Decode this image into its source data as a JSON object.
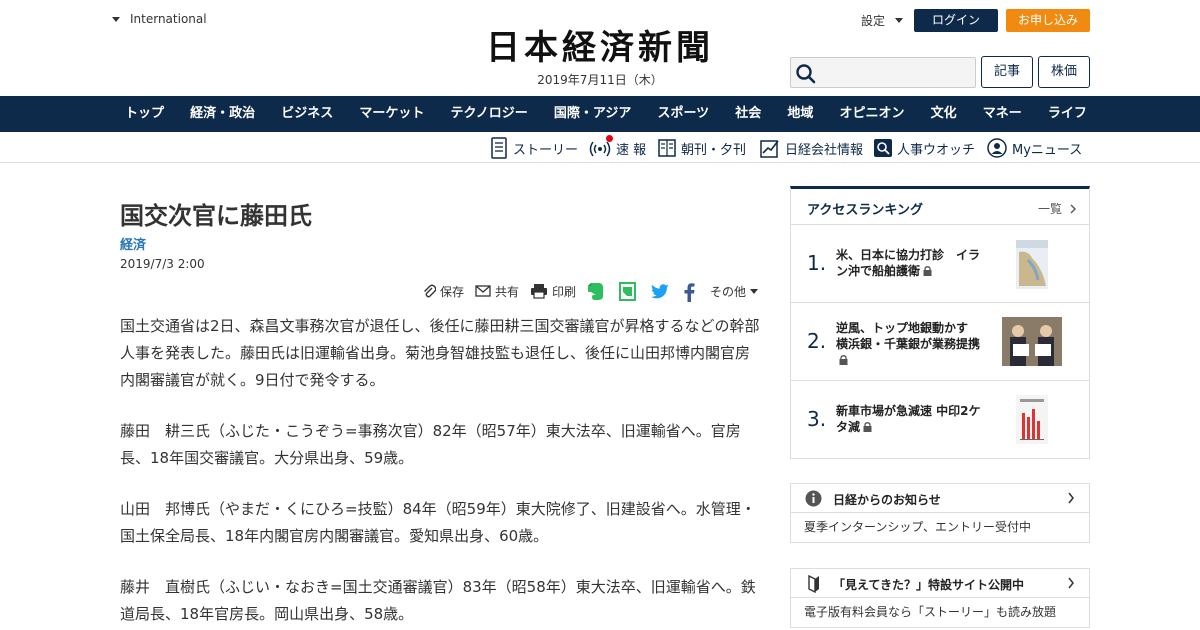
{
  "header": {
    "edition": "International",
    "logo": "日本経済新聞",
    "date": "2019年7月11日（木）",
    "settings": "設定",
    "login": "ログイン",
    "apply": "お申し込み",
    "search_placeholder": "",
    "btn_articles": "記事",
    "btn_stocks": "株価"
  },
  "main_nav": [
    "トップ",
    "経済・政治",
    "ビジネス",
    "マーケット",
    "テクノロジー",
    "国際・アジア",
    "スポーツ",
    "社会",
    "地域",
    "オピニオン",
    "文化",
    "マネー",
    "ライフ"
  ],
  "sub_nav": {
    "story": "ストーリー",
    "breaking": "速 報",
    "paper": "朝刊・夕刊",
    "company": "日経会社情報",
    "personnel": "人事ウオッチ",
    "mynews": "Myニュース"
  },
  "article": {
    "title": "国交次官に藤田氏",
    "category": "経済",
    "date": "2019/7/3 2:00",
    "tools": {
      "save": "保存",
      "share": "共有",
      "print": "印刷",
      "other": "その他"
    },
    "paragraphs": [
      "国土交通省は2日、森昌文事務次官が退任し、後任に藤田耕三国交審議官が昇格するなどの幹部人事を発表した。藤田氏は旧運輸省出身。菊池身智雄技監も退任し、後任に山田邦博内閣官房内閣審議官が就く。9日付で発令する。",
      "藤田　耕三氏（ふじた・こうぞう=事務次官）82年（昭57年）東大法卒、旧運輸省へ。官房長、18年国交審議官。大分県出身、59歳。",
      "山田　邦博氏（やまだ・くにひろ=技監）84年（昭59年）東大院修了、旧建設省へ。水管理・国土保全局長、18年内閣官房内閣審議官。愛知県出身、60歳。",
      "藤井　直樹氏（ふじい・なおき=国土交通審議官）83年（昭58年）東大法卒、旧運輸省へ。鉄道局長、18年官房長。岡山県出身、58歳。"
    ]
  },
  "ranking": {
    "title": "アクセスランキング",
    "more": "一覧",
    "items": [
      {
        "rank": "1.",
        "title": "米、日本に協力打診　イラン沖で船舶護衛"
      },
      {
        "rank": "2.",
        "title": "逆風、トップ地銀動かす　横浜銀・千葉銀が業務提携"
      },
      {
        "rank": "3.",
        "title": "新車市場が急減速 中印2ケタ減"
      }
    ]
  },
  "notices": [
    {
      "title": "日経からのお知らせ",
      "body": "夏季インターンシップ、エントリー受付中"
    },
    {
      "title": "「見えてきた？」特設サイト公開中",
      "body": "電子版有料会員なら「ストーリー」も読み放題"
    }
  ],
  "colors": {
    "navy": "#0e2a4a",
    "orange": "#f08a10",
    "link_blue": "#2776b8",
    "evernote_green": "#2dbe60",
    "twitter_blue": "#1da1f2",
    "facebook_blue": "#3b5998",
    "red_dot": "#e60012"
  }
}
